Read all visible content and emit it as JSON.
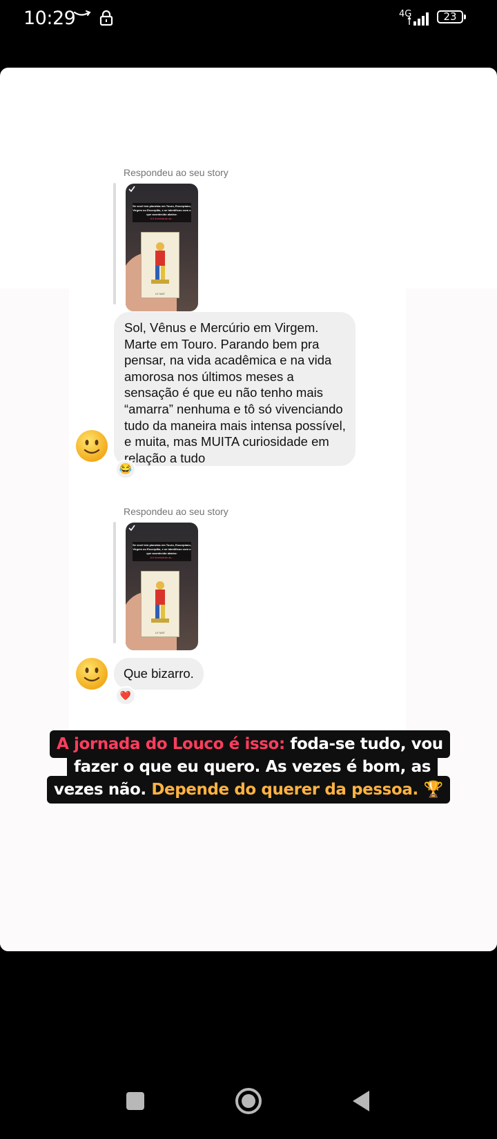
{
  "status_bar": {
    "time": "10:29",
    "network": "4G",
    "battery": "23"
  },
  "story": {
    "messages": [
      {
        "reply_label": "Respondeu ao seu story",
        "story_thumb": {
          "overlay_text": "Se você tem planetas em Touro, Escorpiano, Virgem ou Escorpião, e se identificou com o que acontecido abaixo:",
          "overlay_highlight": "A ti dominarás as...",
          "card_caption": "LE MAT"
        },
        "text": "Sol, Vênus e Mercúrio em Virgem. Marte em Touro. Parando bem pra pensar, na vida acadêmica e na vida amorosa nos últimos meses a sensação é que eu não tenho mais “amarra” nenhuma e tô só vivenciando tudo da maneira mais intensa possível, e muita, mas MUITA curiosidade em relação a tudo",
        "reaction": "😂"
      },
      {
        "reply_label": "Respondeu ao seu story",
        "story_thumb": {
          "overlay_text": "Se você tem planetas em Touro, Escorpiano, Virgem ou Escorpião, e se identificou com o que acontecido abaixo:",
          "overlay_highlight": "A ti dominarás as...",
          "card_caption": "LE MAT"
        },
        "text": "Que bizarro.",
        "reaction": "❤️"
      }
    ],
    "caption": {
      "line1_highlight": "A jornada do Louco é isso:",
      "line1_rest": " foda-se tudo, vou",
      "line2": "fazer o que eu quero. As vezes é bom, as",
      "line3_start": "vezes não. ",
      "line3_highlight": "Depende do querer da pessoa.",
      "line3_emoji": "🏆"
    }
  },
  "colors": {
    "caption_pink": "#ff3d5e",
    "caption_gold": "#ffb341",
    "bubble_bg": "#efefef"
  },
  "icons": [
    "amazon-smile-icon",
    "lock-icon",
    "signal-icon",
    "battery-icon",
    "smiley-avatar-icon",
    "square-recents-icon",
    "circle-home-icon",
    "triangle-back-icon"
  ]
}
